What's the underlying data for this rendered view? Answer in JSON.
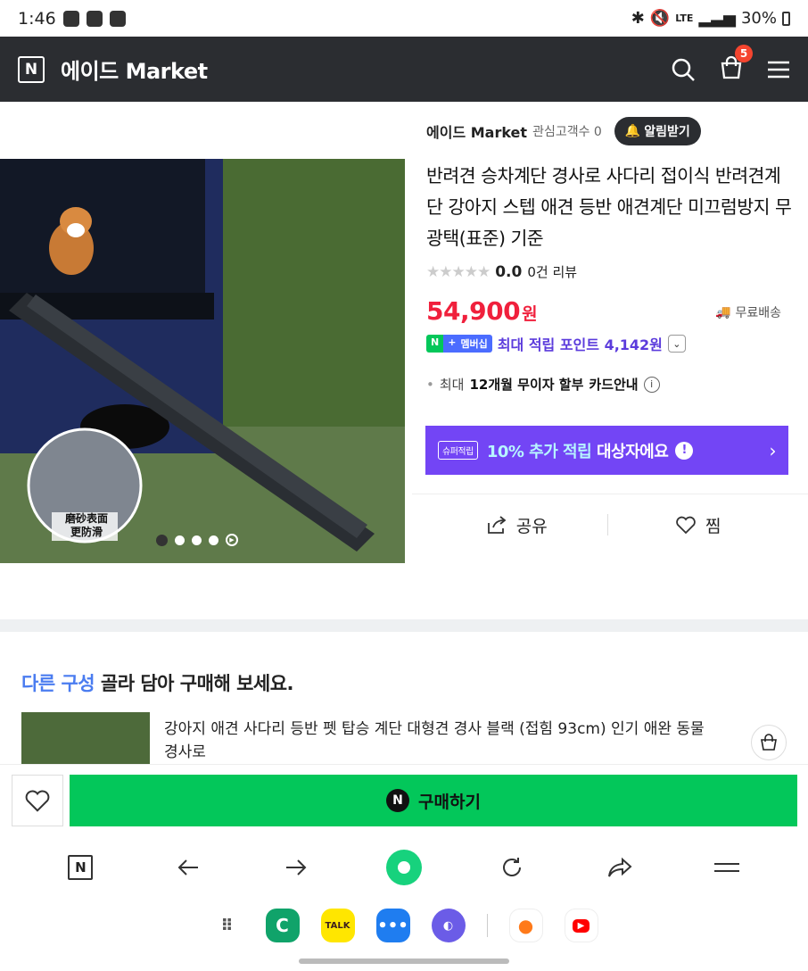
{
  "status": {
    "time": "1:46",
    "battery": "30%",
    "network": "LTE"
  },
  "header": {
    "brand": "에이드 Market",
    "logo_letter": "N",
    "cart_count": "5"
  },
  "product": {
    "shop_name": "에이드 Market",
    "fans_label": "관심고객수 0",
    "alarm_label": "알림받기",
    "title": "반려견 승차계단 경사로 사다리 접이식 반려견계단 강아지 스텝 애견 등반 애견계단 미끄럼방지 무광택(표준) 기준",
    "rating_score": "0.0",
    "review_count": "0건 리뷰",
    "price": "54,900",
    "price_unit": "원",
    "shipping": "무료배송",
    "membership_label": "멤버십",
    "points_text": "최대 적립 포인트 4,142원",
    "installment_prefix": "최대",
    "installment_bold": "12개월 무이자 할부",
    "installment_suffix": "카드안내",
    "image_caption_line1": "磨砂表面",
    "image_caption_line2": "更防滑",
    "image_count": 5,
    "image_active_index": 0
  },
  "super_banner": {
    "tag": "슈퍼적립",
    "highlight": "10% 추가 적립",
    "text": "대상자에요"
  },
  "actions": {
    "share": "공유",
    "wish": "찜"
  },
  "options_section": {
    "title_highlight": "다른 구성",
    "title_rest": "골라 담아 구매해 보세요.",
    "item_title": "강아지 애견 사다리 등반 펫 탑승 계단 대형견 경사 블랙 (접힘 93cm) 인기 애완 동물 경사로"
  },
  "buy": {
    "label": "구매하기",
    "logo": "N"
  },
  "dock": {
    "kakao_label": "TALK"
  },
  "colors": {
    "naver_green": "#03c75a",
    "price_red": "#f0203c",
    "super_purple": "#7345f5",
    "header_dark": "#2b2d31"
  }
}
